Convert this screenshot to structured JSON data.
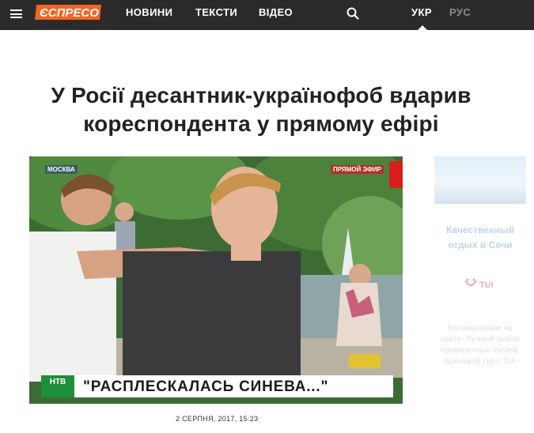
{
  "header": {
    "logo_text": "ЄСПРЕСО",
    "nav": [
      {
        "label": "НОВИНИ"
      },
      {
        "label": "ТЕКСТИ"
      },
      {
        "label": "ВІДЕО"
      }
    ],
    "languages": {
      "active": "УКР",
      "inactive": "РУС"
    }
  },
  "article": {
    "headline_line1": "У Росії десантник-українофоб вдарив",
    "headline_line2": "кореспондента у прямому ефірі",
    "media": {
      "location_tag": "МОСКВА",
      "live_tag": "ПРЯМОЙ ЭФИР",
      "ticker_text": "\"РАСПЛЕСКАЛАСЬ СИНЕВА...\"",
      "channel_logo": "НТВ"
    },
    "date": "2 СЕРПНЯ, 2017, 15:23"
  },
  "sidebar_ad": {
    "title": "Качественный отдых в Сочи",
    "brand": "TUI",
    "text": "Бронирование на сайте. Лучший выбор проверенных отелей. Бронируй тур с TUI"
  },
  "colors": {
    "topbar": "#2b2b2b",
    "logo_orange": "#f26522",
    "ad_link": "#3a7bc0"
  }
}
